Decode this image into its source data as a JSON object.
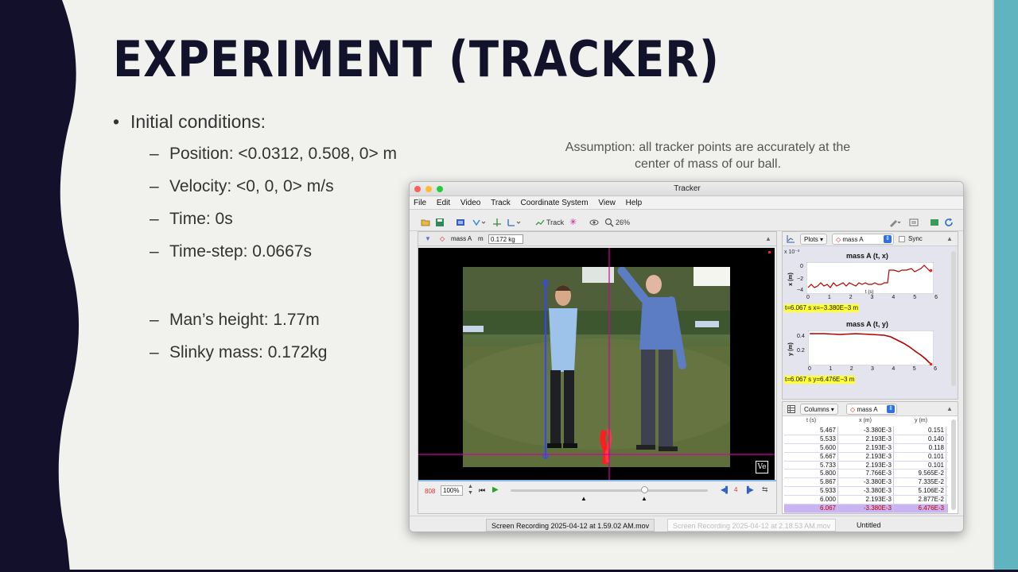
{
  "slide": {
    "title": "EXPERIMENT (TRACKER)",
    "main_bullet": "Initial conditions:",
    "conditions": [
      "Position: <0.0312, 0.508, 0> m",
      "Velocity: <0, 0, 0> m/s",
      "Time: 0s",
      "Time-step: 0.0667s"
    ],
    "facts": [
      "Man’s height: 1.77m",
      "Slinky mass: 0.172kg"
    ],
    "assumption": "Assumption: all tracker points are accurately at the center of mass of our ball.",
    "colors": {
      "background": "#f1f1ee",
      "left_band": "#12102a",
      "right_band": "#5fb4bf"
    }
  },
  "tracker": {
    "title": "Tracker",
    "menu": [
      "File",
      "Edit",
      "Video",
      "Track",
      "Coordinate System",
      "View",
      "Help"
    ],
    "toolbar": {
      "track_label": "Track",
      "zoom": "26%"
    },
    "video_panel": {
      "track_name": "mass A",
      "mass_unit": "m",
      "mass_value": "0.172 kg",
      "frame": "808",
      "rate": "100%",
      "step": "4",
      "watermark": "Ve"
    },
    "plots": {
      "menu_label": "Plots",
      "track_name": "mass A",
      "sync_label": "Sync",
      "plot1": {
        "title": "mass A (t, x)",
        "exponent": "x 10⁻³",
        "ylabel": "x (m)",
        "xlabel": "t (s)",
        "yticks": [
          "0",
          "−2",
          "−4"
        ],
        "xticks": [
          "0",
          "1",
          "2",
          "3",
          "4",
          "5",
          "6"
        ],
        "readout": "t=6.067 s  x=−3.380E−3 m"
      },
      "plot2": {
        "title": "mass A (t, y)",
        "ylabel": "y (m)",
        "yticks": [
          "0.4",
          "0.2"
        ],
        "xticks": [
          "0",
          "1",
          "2",
          "3",
          "4",
          "5",
          "6"
        ],
        "readout": "t=6.067 s  y=6.476E−3 m"
      }
    },
    "table": {
      "menu_label": "Columns",
      "track_name": "mass A",
      "headers": [
        "t (s)",
        "x (m)",
        "y (m)"
      ],
      "rows": [
        [
          "5.467",
          "-3.380E-3",
          "0.151"
        ],
        [
          "5.533",
          "2.193E-3",
          "0.140"
        ],
        [
          "5.600",
          "2.193E-3",
          "0.118"
        ],
        [
          "5.667",
          "2.193E-3",
          "0.101"
        ],
        [
          "5.733",
          "2.193E-3",
          "0.101"
        ],
        [
          "5.800",
          "7.766E-3",
          "9.565E-2"
        ],
        [
          "5.867",
          "-3.380E-3",
          "7.335E-2"
        ],
        [
          "5.933",
          "-3.380E-3",
          "5.106E-2"
        ],
        [
          "6.000",
          "2.193E-3",
          "2.877E-2"
        ],
        [
          "6.067",
          "-3.380E-3",
          "6.476E-3"
        ]
      ]
    },
    "status_tabs": [
      "Screen Recording 2025-04-12 at 1.59.02 AM.mov",
      "Screen Recording 2025-04-12 at 2.18.53 AM.mov",
      "Untitled"
    ]
  }
}
